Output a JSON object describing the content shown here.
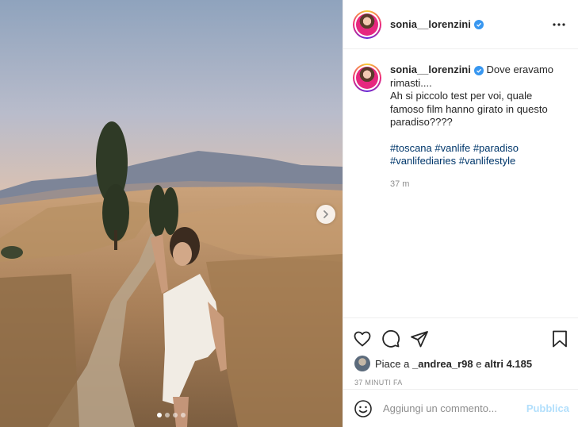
{
  "post": {
    "username": "sonia__lorenzini",
    "verified_icon": "verified-badge-icon",
    "more_icon": "more-options-icon",
    "caption": {
      "username": "sonia__lorenzini",
      "text": "Dove eravamo rimasti....\nAh si piccolo test per voi, quale famoso film hanno girato in questo paradiso????",
      "hashtags": [
        "#toscana",
        "#vanlife",
        "#paradiso",
        "#vanlifediaries",
        "#vanlifestyle"
      ],
      "time_ago": "37 m"
    },
    "media": {
      "carousel_count": 4,
      "active_index": 0,
      "next_icon": "chevron-right-icon"
    },
    "actions": {
      "like_icon": "heart-icon",
      "comment_icon": "comment-icon",
      "share_icon": "send-icon",
      "save_icon": "bookmark-icon"
    },
    "likes": {
      "prefix": "Piace a",
      "user": "_andrea_r98",
      "middle": "e",
      "others": "altri 4.185"
    },
    "date": "37 MINUTI FA",
    "comment": {
      "placeholder": "Aggiungi un commento...",
      "publish_label": "Pubblica",
      "emoji_icon": "smiley-icon"
    }
  },
  "colors": {
    "link": "#00376b",
    "verified": "#3897f0",
    "muted": "#8e8e8e",
    "publish_disabled": "#b2dffc",
    "border": "#efefef"
  }
}
